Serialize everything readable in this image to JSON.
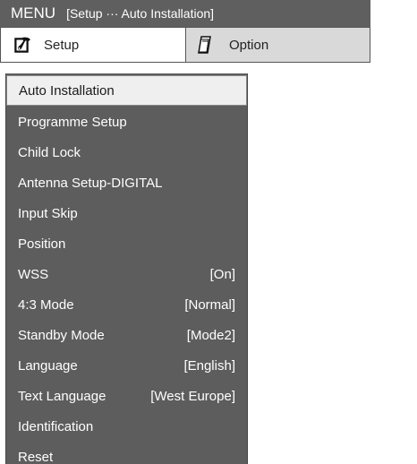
{
  "title_bar": {
    "menu_label": "MENU",
    "path": "[Setup ··· Auto Installation]"
  },
  "tabs": [
    {
      "label": "Setup",
      "icon": "wrench-icon",
      "active": true
    },
    {
      "label": "Option",
      "icon": "card-icon",
      "active": false
    }
  ],
  "menu": {
    "items": [
      {
        "label": "Auto Installation",
        "value": "",
        "selected": true
      },
      {
        "label": "Programme Setup",
        "value": ""
      },
      {
        "label": "Child Lock",
        "value": ""
      },
      {
        "label": "Antenna Setup-DIGITAL",
        "value": ""
      },
      {
        "label": "Input Skip",
        "value": ""
      },
      {
        "label": "Position",
        "value": ""
      },
      {
        "label": "WSS",
        "value": "[On]"
      },
      {
        "label": "4:3 Mode",
        "value": "[Normal]"
      },
      {
        "label": "Standby Mode",
        "value": "[Mode2]"
      },
      {
        "label": "Language",
        "value": "[English]"
      },
      {
        "label": "Text Language",
        "value": "[West Europe]"
      },
      {
        "label": "Identification",
        "value": ""
      },
      {
        "label": "Reset",
        "value": ""
      }
    ]
  },
  "colors": {
    "title_bar_bg": "#5f5f5f",
    "menu_bg": "#5d5d5d",
    "selected_bg": "#efefef",
    "inactive_tab_bg": "#d9d9d9"
  }
}
